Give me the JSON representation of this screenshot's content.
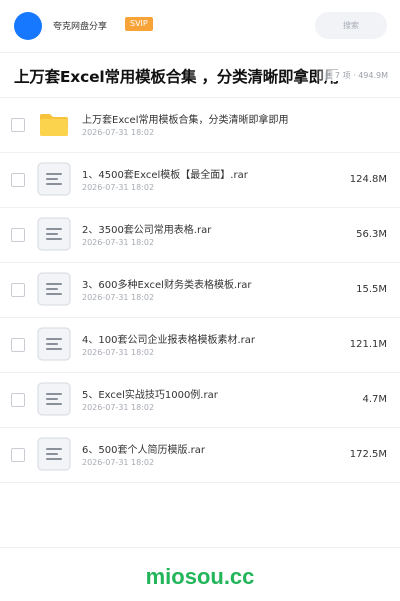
{
  "header": {
    "share_title": "夸克网盘分享",
    "svip_label": "SVIP",
    "search_label": "搜索",
    "accent_color": "#1677ff"
  },
  "page": {
    "title": "上万套Excel常用模板合集 ，分类清晰即拿即用",
    "meta": "共 7 项 · 494.9M"
  },
  "files": [
    {
      "name": "上万套Excel常用模板合集，分类清晰即拿即用",
      "date": "2026-07-31 18:02",
      "size": "",
      "icon": "folder-icon"
    },
    {
      "name": "1、4500套Excel模板【最全面】.rar",
      "date": "2026-07-31 18:02",
      "size": "124.8M",
      "icon": "archive-file-icon"
    },
    {
      "name": "2、3500套公司常用表格.rar",
      "date": "2026-07-31 18:02",
      "size": "56.3M",
      "icon": "archive-file-icon"
    },
    {
      "name": "3、600多种Excel财务类表格模板.rar",
      "date": "2026-07-31 18:02",
      "size": "15.5M",
      "icon": "archive-file-icon"
    },
    {
      "name": "4、100套公司企业报表格模板素材.rar",
      "date": "2026-07-31 18:02",
      "size": "121.1M",
      "icon": "archive-file-icon"
    },
    {
      "name": "5、Excel实战技巧1000例.rar",
      "date": "2026-07-31 18:02",
      "size": "4.7M",
      "icon": "archive-file-icon"
    },
    {
      "name": "6、500套个人简历模版.rar",
      "date": "2026-07-31 18:02",
      "size": "172.5M",
      "icon": "archive-file-icon"
    }
  ],
  "footer": {
    "watermark": "miosou.cc",
    "watermark_color": "#22b55a"
  }
}
